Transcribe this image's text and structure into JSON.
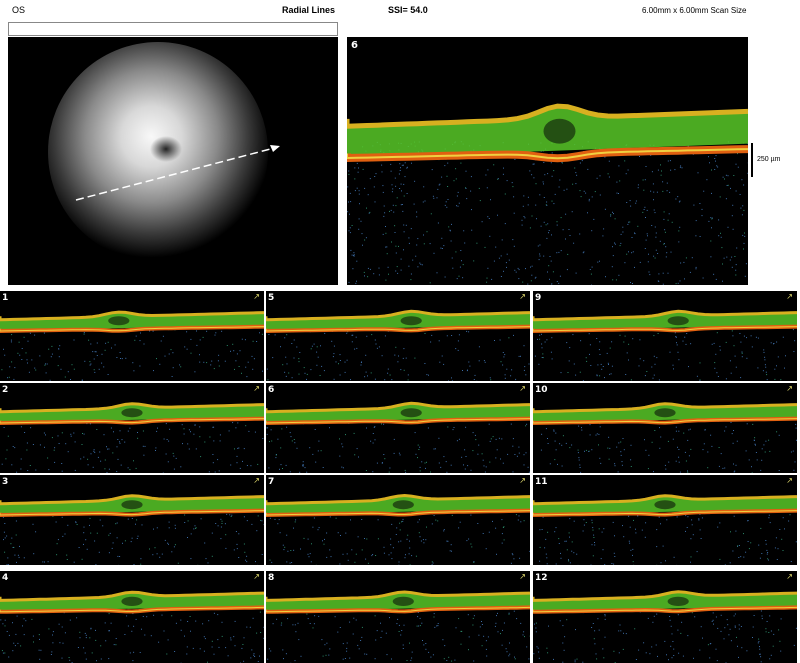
{
  "header": {
    "eye": "OS",
    "scan_type": "Radial Lines",
    "ssi": "SSI= 54.0",
    "scan_size": "6.00mm x 6.00mm Scan Size"
  },
  "main_scan": {
    "number": "6"
  },
  "scale": {
    "label": "250 µm"
  },
  "thumbnails": [
    {
      "number": "1",
      "dip": 0.45
    },
    {
      "number": "5",
      "dip": 0.55
    },
    {
      "number": "9",
      "dip": 0.55
    },
    {
      "number": "2",
      "dip": 0.5
    },
    {
      "number": "6",
      "dip": 0.55
    },
    {
      "number": "10",
      "dip": 0.5
    },
    {
      "number": "3",
      "dip": 0.5
    },
    {
      "number": "7",
      "dip": 0.52
    },
    {
      "number": "11",
      "dip": 0.5
    },
    {
      "number": "4",
      "dip": 0.5
    },
    {
      "number": "8",
      "dip": 0.52
    },
    {
      "number": "12",
      "dip": 0.55
    }
  ],
  "colors": {
    "fundus_glow": "#f4f4f4",
    "rpe": "#e06010",
    "retina": "#58c828",
    "noise": "#3d6ea8"
  }
}
